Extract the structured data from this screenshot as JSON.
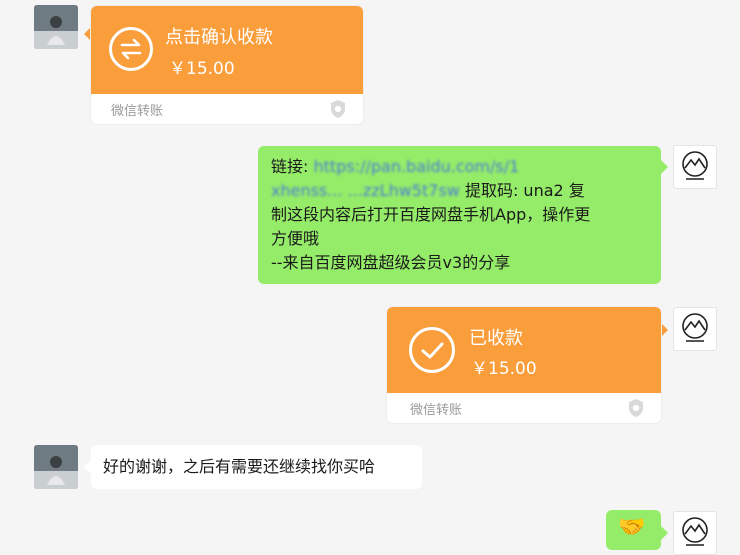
{
  "messages": {
    "m1": {
      "status": "点击确认收款",
      "amount": "￥15.00",
      "label": "微信转账",
      "icon": "transfer-arrows-icon"
    },
    "m2": {
      "link_prefix": "链接:",
      "link_text": "https://pan.baidu.com/s/1",
      "link_line2": "xhenss... ...zzLhw5t7sw",
      "code_text": "提取码: una2 复",
      "line3": "制这段内容后打开百度网盘手机App，操作更",
      "line4": "方便哦",
      "line5": "--来自百度网盘超级会员v3的分享"
    },
    "m3": {
      "status": "已收款",
      "amount": "￥15.00",
      "label": "微信转账",
      "icon": "check-circle-icon"
    },
    "m4": {
      "text": "好的谢谢，之后有需要还继续找你买哈"
    },
    "m5": {
      "emoji": "🤝",
      "icon": "handshake-icon"
    }
  },
  "colors": {
    "transfer_orange": "#fa9d3b",
    "bubble_green": "#95ec69",
    "background": "#f5f5f5"
  }
}
